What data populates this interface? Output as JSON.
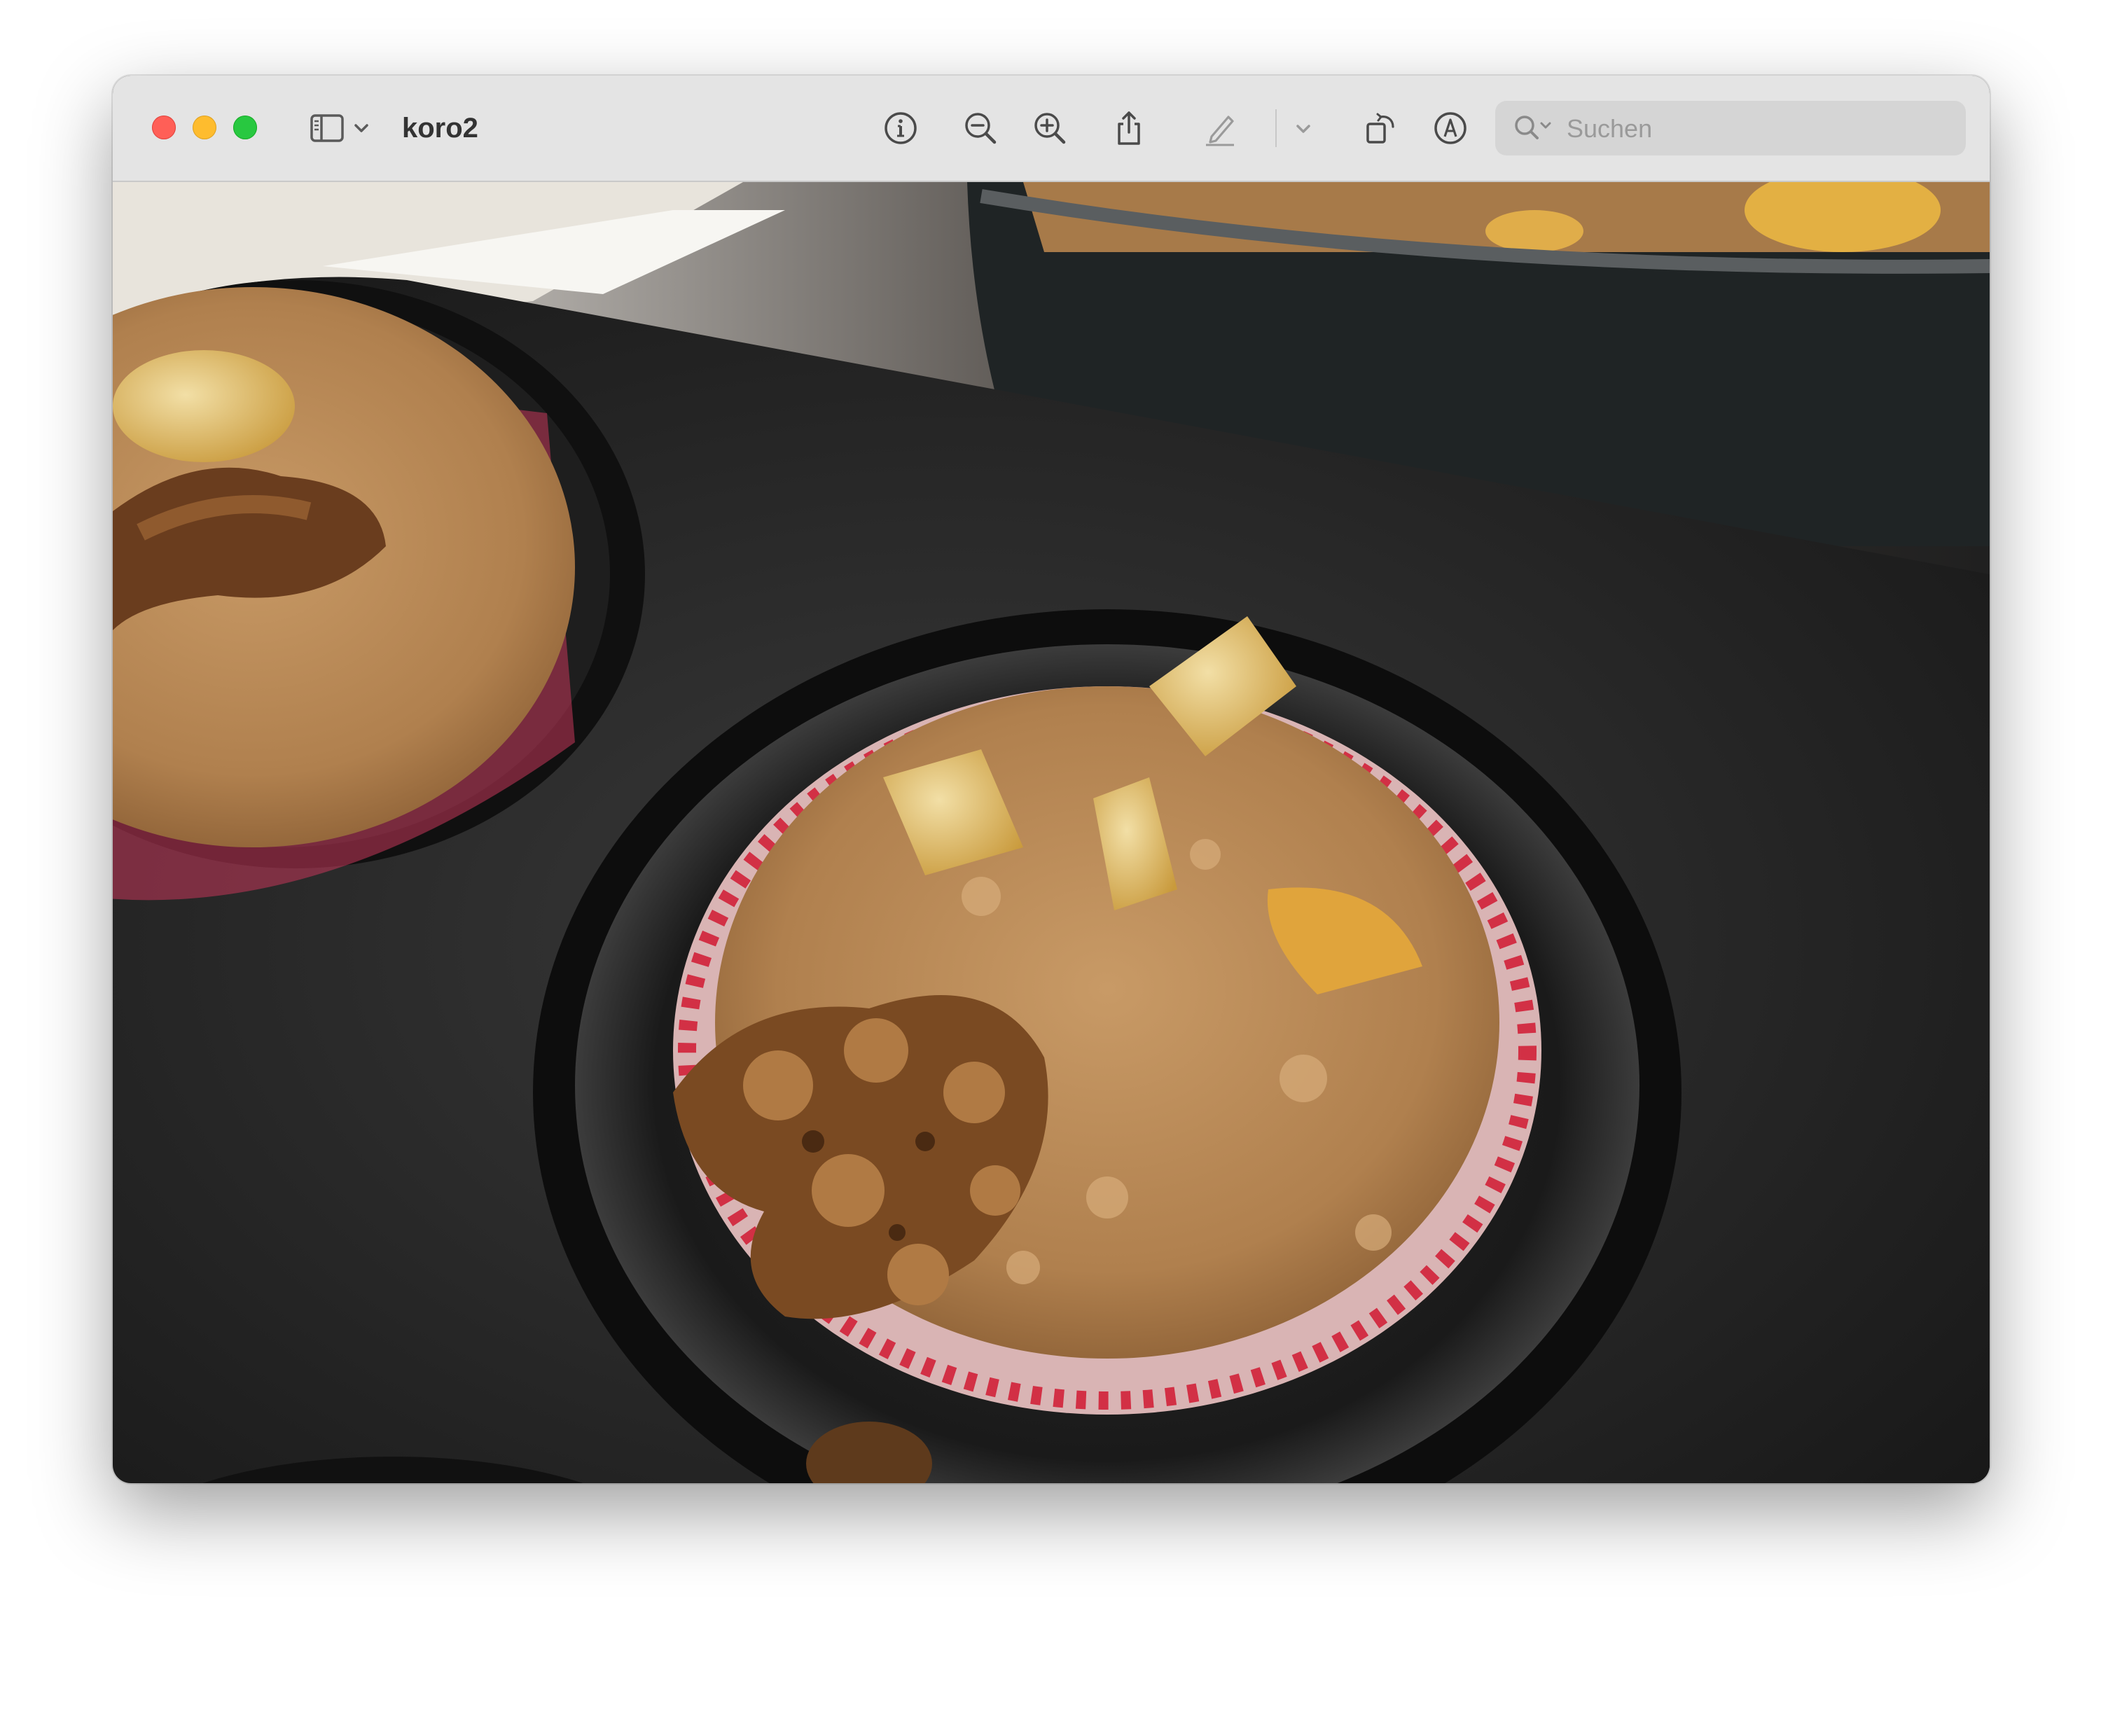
{
  "window": {
    "title": "koro2",
    "traffic_lights": {
      "close": "#ff5f57",
      "minimize": "#febc2e",
      "zoom": "#28c840"
    }
  },
  "toolbar": {
    "icons": [
      "sidebar-icon",
      "chevron-down-icon",
      "info-icon",
      "zoom-out-icon",
      "zoom-in-icon",
      "share-icon",
      "markup-pencil-icon",
      "chevron-down-icon",
      "rotate-icon",
      "annotate-icon"
    ],
    "search_placeholder": "Suchen"
  },
  "image": {
    "subject": "photo"
  }
}
